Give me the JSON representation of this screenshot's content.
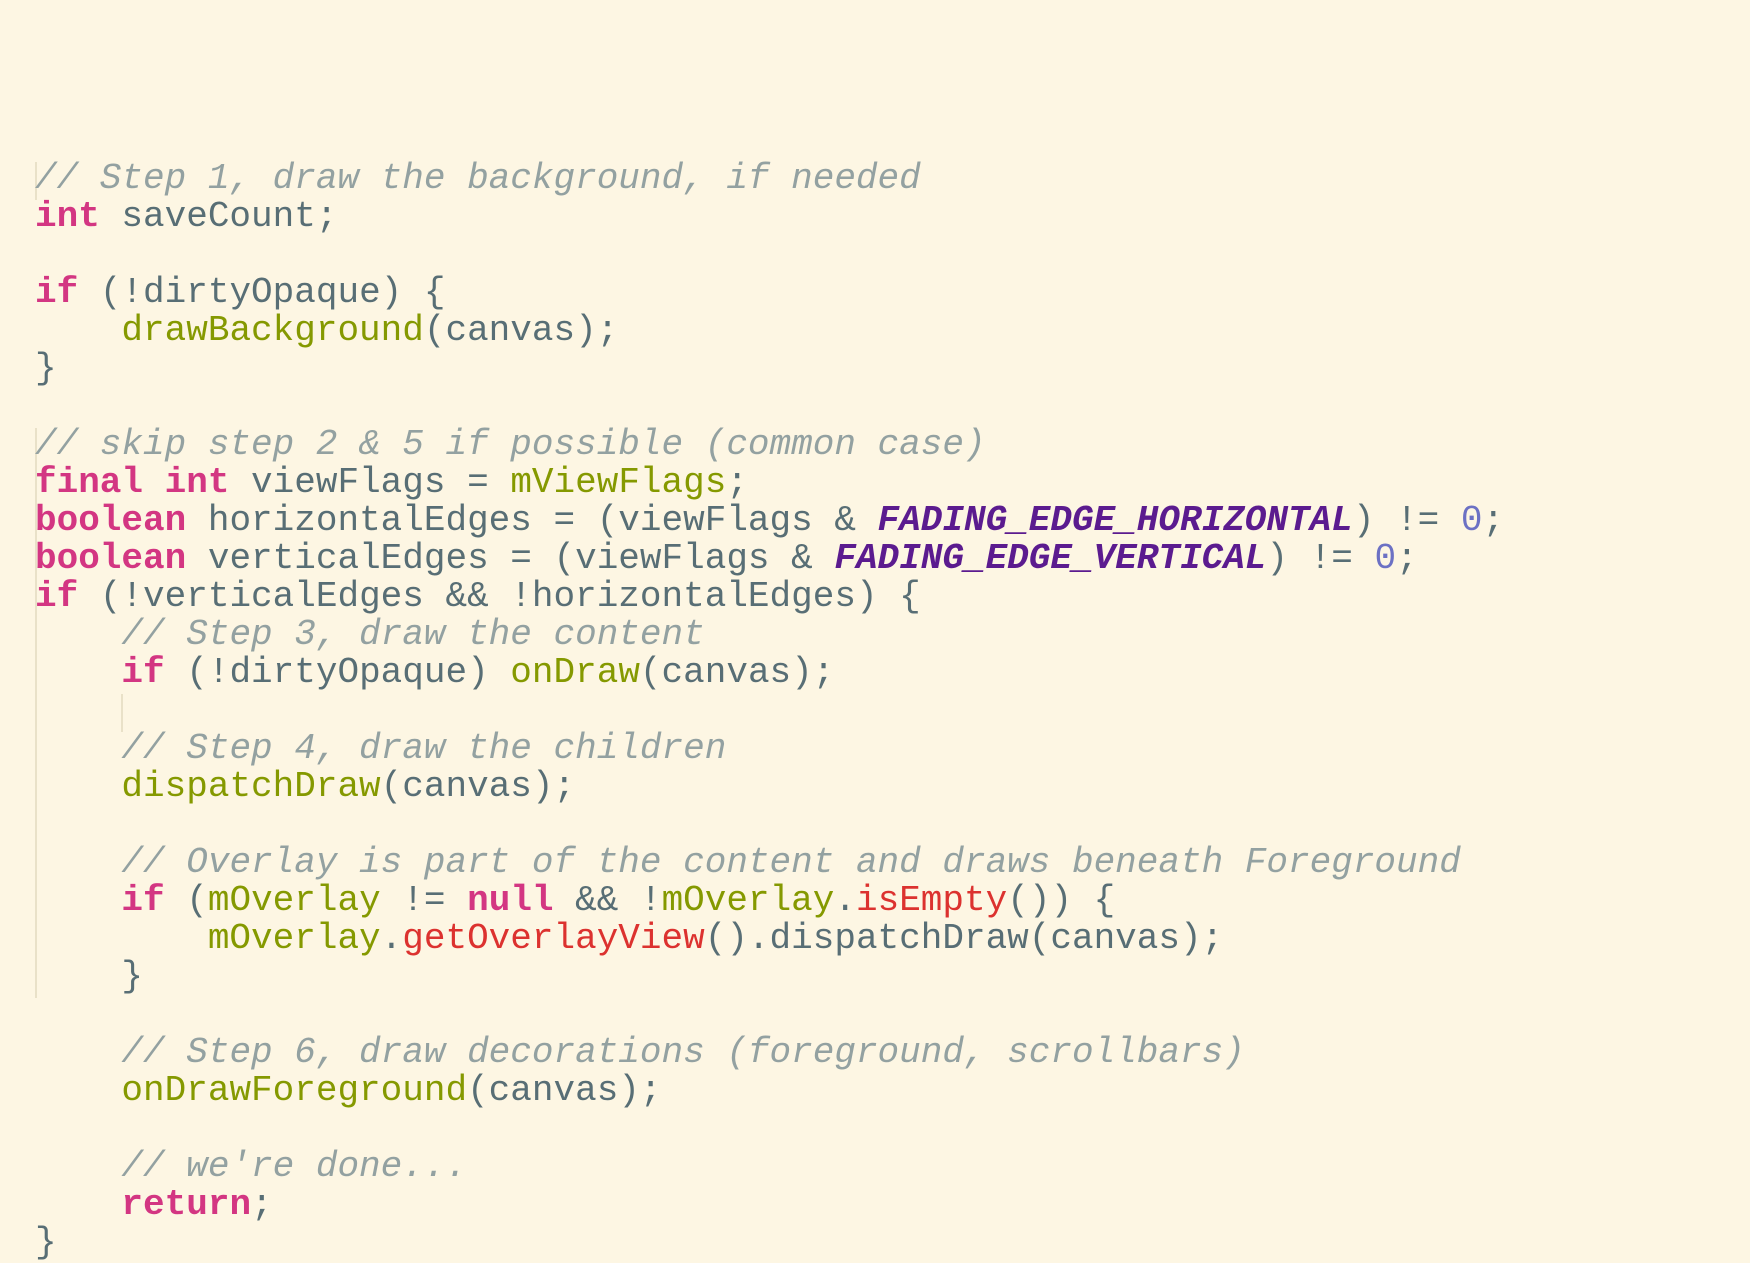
{
  "editor": {
    "background": "#fdf6e3",
    "colors": {
      "comment": "#93a1a1",
      "keyword": "#d33682",
      "function": "#859900",
      "constant": "#5b1b8f",
      "number": "#6c71c4",
      "method": "#dc322f",
      "text": "#586e75"
    },
    "lines": [
      [
        [
          "com",
          "// Step 1, draw the background, if needed"
        ]
      ],
      [
        [
          "kw",
          "int"
        ],
        [
          "txt",
          " saveCount;"
        ]
      ],
      [],
      [
        [
          "kw",
          "if"
        ],
        [
          "txt",
          " (!dirtyOpaque) {"
        ]
      ],
      [
        [
          "txt",
          "    "
        ],
        [
          "fn",
          "drawBackground"
        ],
        [
          "txt",
          "(canvas);"
        ]
      ],
      [
        [
          "txt",
          "}"
        ]
      ],
      [],
      [
        [
          "com",
          "// skip step 2 & 5 if possible (common case)"
        ]
      ],
      [
        [
          "kw",
          "final"
        ],
        [
          "txt",
          " "
        ],
        [
          "kw",
          "int"
        ],
        [
          "txt",
          " viewFlags = "
        ],
        [
          "var",
          "mViewFlags"
        ],
        [
          "txt",
          ";"
        ]
      ],
      [
        [
          "kw",
          "boolean"
        ],
        [
          "txt",
          " horizontalEdges = (viewFlags & "
        ],
        [
          "cst",
          "FADING_EDGE_HORIZONTAL"
        ],
        [
          "txt",
          ") != "
        ],
        [
          "num",
          "0"
        ],
        [
          "txt",
          ";"
        ]
      ],
      [
        [
          "kw",
          "boolean"
        ],
        [
          "txt",
          " verticalEdges = (viewFlags & "
        ],
        [
          "cst",
          "FADING_EDGE_VERTICAL"
        ],
        [
          "txt",
          ") != "
        ],
        [
          "num",
          "0"
        ],
        [
          "txt",
          ";"
        ]
      ],
      [
        [
          "kw",
          "if"
        ],
        [
          "txt",
          " (!verticalEdges && !horizontalEdges) {"
        ]
      ],
      [
        [
          "txt",
          "    "
        ],
        [
          "com",
          "// Step 3, draw the content"
        ]
      ],
      [
        [
          "txt",
          "    "
        ],
        [
          "kw",
          "if"
        ],
        [
          "txt",
          " (!dirtyOpaque) "
        ],
        [
          "fn",
          "onDraw"
        ],
        [
          "txt",
          "(canvas);"
        ]
      ],
      [],
      [
        [
          "txt",
          "    "
        ],
        [
          "com",
          "// Step 4, draw the children"
        ]
      ],
      [
        [
          "txt",
          "    "
        ],
        [
          "fn",
          "dispatchDraw"
        ],
        [
          "txt",
          "(canvas);"
        ]
      ],
      [],
      [
        [
          "txt",
          "    "
        ],
        [
          "com",
          "// Overlay is part of the content and draws beneath Foreground"
        ]
      ],
      [
        [
          "txt",
          "    "
        ],
        [
          "kw",
          "if"
        ],
        [
          "txt",
          " ("
        ],
        [
          "var",
          "mOverlay"
        ],
        [
          "txt",
          " != "
        ],
        [
          "kw",
          "null"
        ],
        [
          "txt",
          " && !"
        ],
        [
          "var",
          "mOverlay"
        ],
        [
          "txt",
          "."
        ],
        [
          "api",
          "isEmpty"
        ],
        [
          "txt",
          "()) {"
        ]
      ],
      [
        [
          "txt",
          "        "
        ],
        [
          "var",
          "mOverlay"
        ],
        [
          "txt",
          "."
        ],
        [
          "api",
          "getOverlayView"
        ],
        [
          "txt",
          "().dispatchDraw(canvas);"
        ]
      ],
      [
        [
          "txt",
          "    }"
        ]
      ],
      [],
      [
        [
          "txt",
          "    "
        ],
        [
          "com",
          "// Step 6, draw decorations (foreground, scrollbars)"
        ]
      ],
      [
        [
          "txt",
          "    "
        ],
        [
          "fn",
          "onDrawForeground"
        ],
        [
          "txt",
          "(canvas);"
        ]
      ],
      [],
      [
        [
          "txt",
          "    "
        ],
        [
          "com",
          "// we're done..."
        ]
      ],
      [
        [
          "txt",
          "    "
        ],
        [
          "kw",
          "return"
        ],
        [
          "txt",
          ";"
        ]
      ],
      [
        [
          "txt",
          "}"
        ]
      ]
    ]
  }
}
